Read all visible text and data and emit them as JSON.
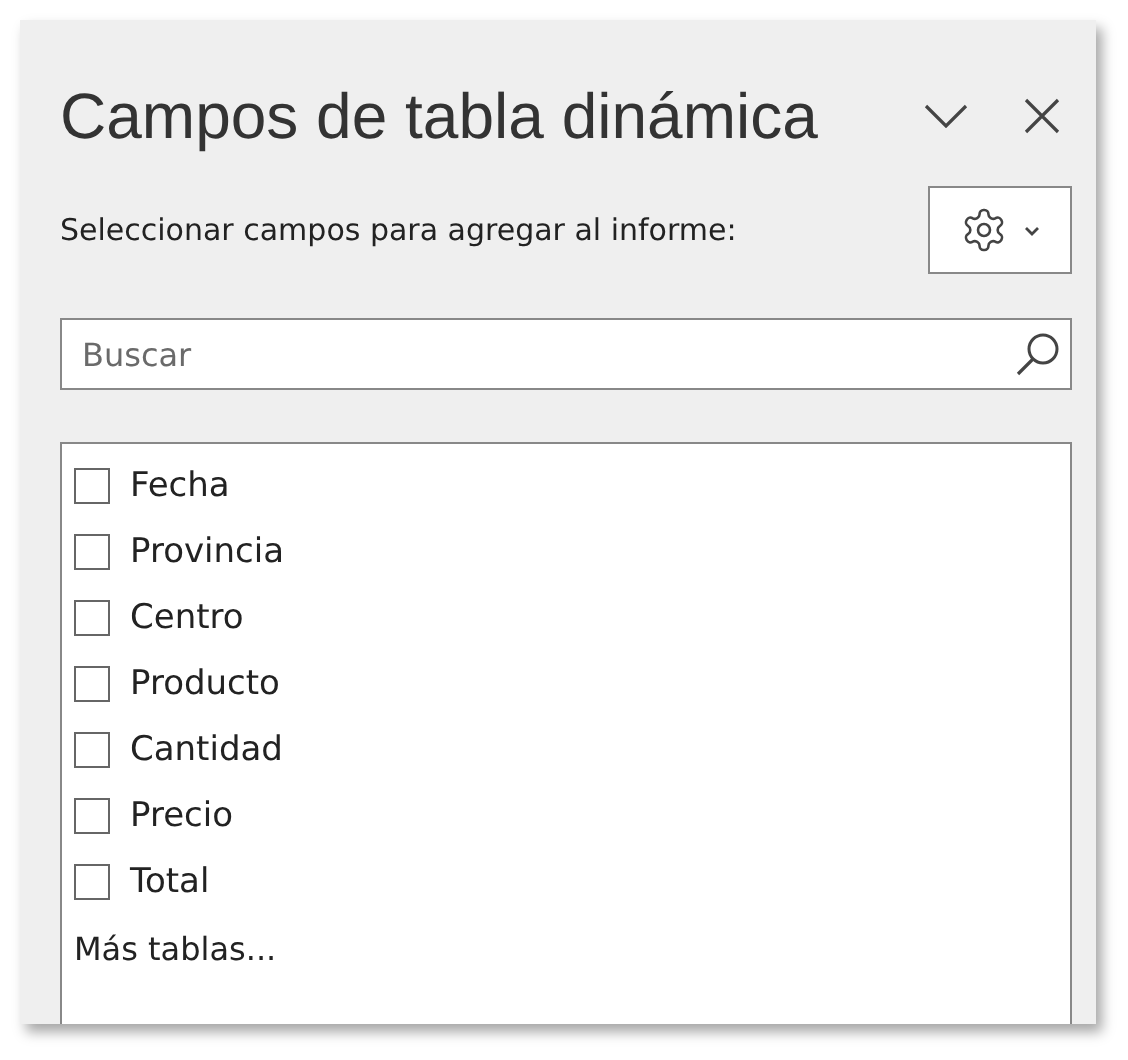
{
  "panel": {
    "title": "Campos de tabla dinámica",
    "subtitle": "Seleccionar campos para agregar al informe:"
  },
  "search": {
    "placeholder": "Buscar"
  },
  "fields": [
    {
      "label": "Fecha",
      "checked": false
    },
    {
      "label": "Provincia",
      "checked": false
    },
    {
      "label": "Centro",
      "checked": false
    },
    {
      "label": "Producto",
      "checked": false
    },
    {
      "label": "Cantidad",
      "checked": false
    },
    {
      "label": "Precio",
      "checked": false
    },
    {
      "label": "Total",
      "checked": false
    }
  ],
  "more_tables": "Más tablas..."
}
